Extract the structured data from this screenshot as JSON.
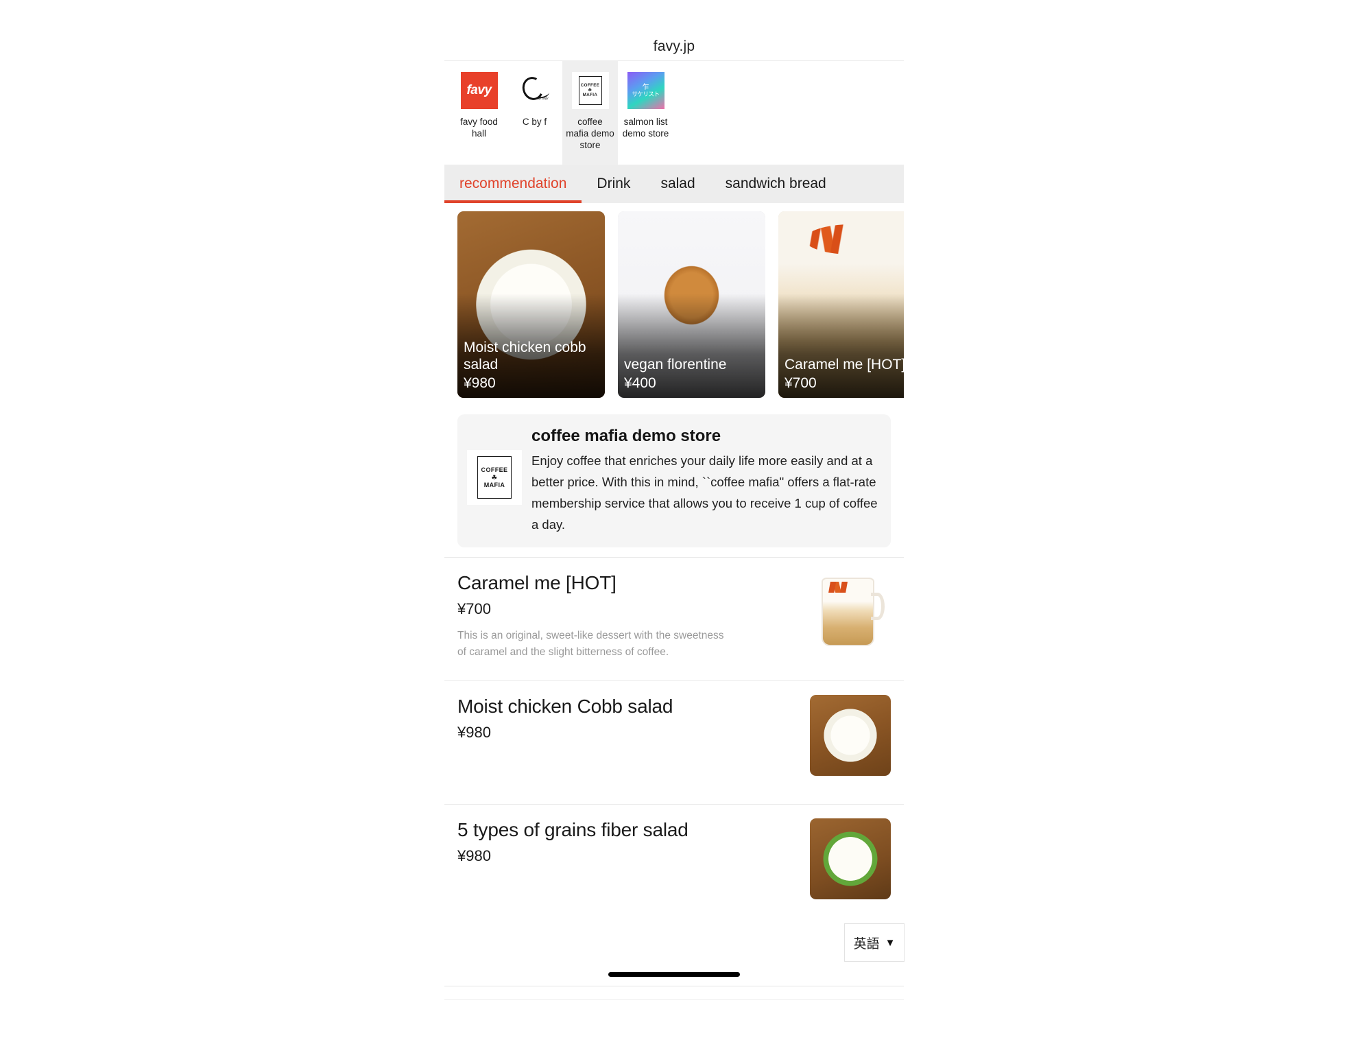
{
  "browser": {
    "site_title": "favy.jp"
  },
  "store_switcher": {
    "stores": [
      {
        "label": "favy food hall",
        "logo": "favy-logo",
        "active": false
      },
      {
        "label": "C by f",
        "logo": "c-by-f-logo",
        "active": false
      },
      {
        "label": "coffee mafia demo store",
        "logo": "coffee-mafia-logo",
        "active": true
      },
      {
        "label": "salmon list demo store",
        "logo": "salmon-list-logo",
        "active": false
      }
    ]
  },
  "category_tabs": {
    "active_index": 0,
    "accent_color": "#e0432b",
    "items": [
      {
        "label": "recommendation"
      },
      {
        "label": "Drink"
      },
      {
        "label": "salad"
      },
      {
        "label": "sandwich bread"
      }
    ]
  },
  "carousel": {
    "cards": [
      {
        "name": "Moist chicken cobb salad",
        "price": "¥980",
        "image": "cobb-salad-photo"
      },
      {
        "name": "vegan florentine",
        "price": "¥400",
        "image": "vegan-florentine-photo"
      },
      {
        "name": "Caramel me [HOT]",
        "price": "¥700",
        "image": "caramel-drink-photo"
      }
    ]
  },
  "store_info": {
    "logo": "coffee-mafia-logo",
    "title": "coffee mafia demo store",
    "description": "Enjoy coffee that enriches your daily life more easily and at a better price. With this in mind, ``coffee mafia\" offers a flat-rate membership service that allows you to receive 1 cup of coffee a day."
  },
  "menu": {
    "items": [
      {
        "name": "Caramel me [HOT]",
        "price": "¥700",
        "description": "This is an original, sweet-like dessert with the sweetness of caramel and the slight bitterness of coffee.",
        "image": "caramel-latte-photo"
      },
      {
        "name": "Moist chicken Cobb salad",
        "price": "¥980",
        "description": "",
        "image": "cobb-salad-photo"
      },
      {
        "name": "5 types of grains fiber salad",
        "price": "¥980",
        "description": "",
        "image": "grain-salad-photo"
      }
    ]
  },
  "language_selector": {
    "value": "英語",
    "caret": "▼"
  },
  "logo_text": {
    "favy": "favy",
    "mafia_top": "COFFEE",
    "mafia_mid": "☘",
    "mafia_bottom": "MAFIA",
    "cbyf_sub": "by favy",
    "salmon_mark": "乍",
    "salmon_text": "サケリスト"
  }
}
